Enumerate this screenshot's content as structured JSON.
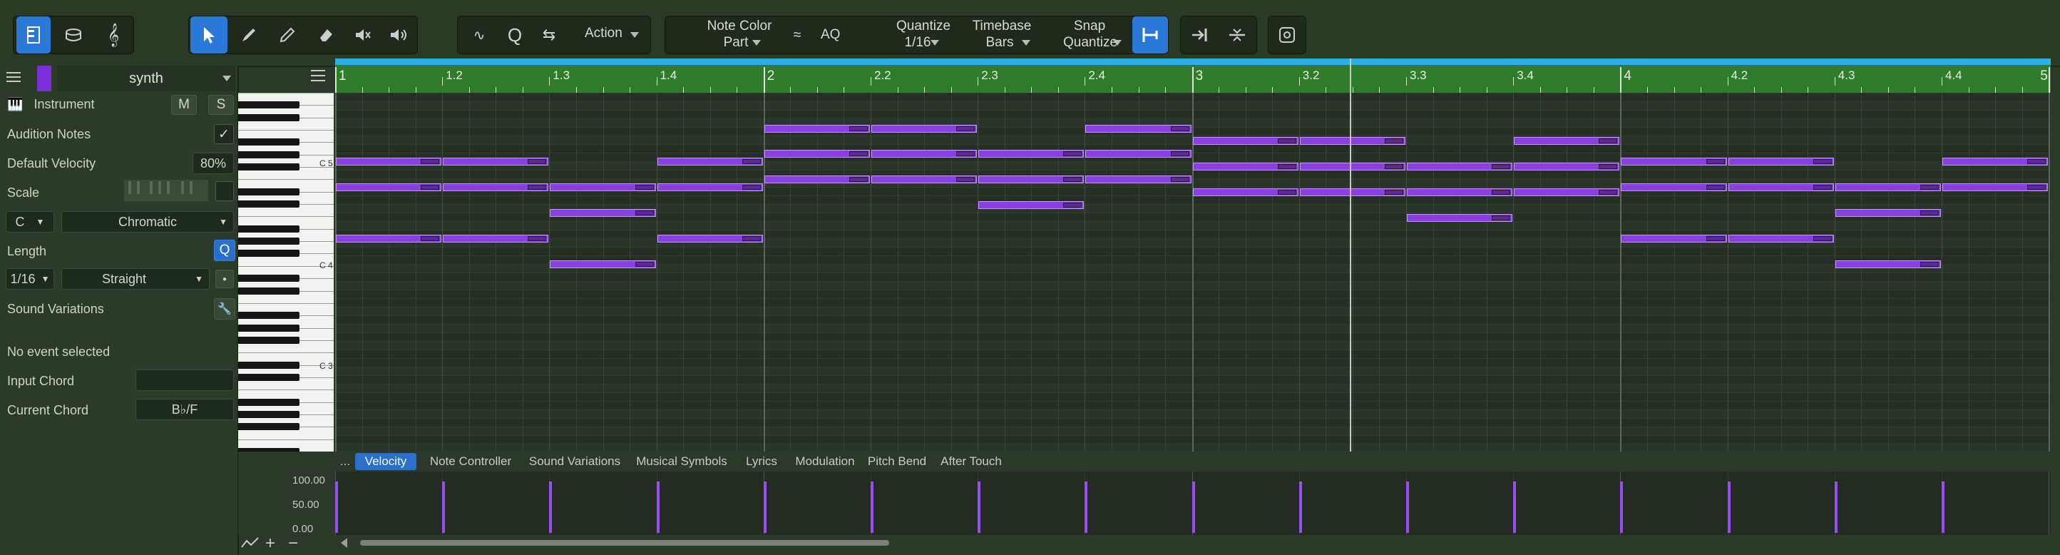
{
  "toolbar": {
    "action_label": "Action",
    "note_color": {
      "label": "Note Color",
      "value": "Part"
    },
    "aq_label": "AQ",
    "quantize": {
      "label": "Quantize",
      "value": "1/16"
    },
    "timebase": {
      "label": "Timebase",
      "value": "Bars"
    },
    "snap": {
      "label": "Snap",
      "value": "Quantize"
    }
  },
  "inspector": {
    "track_name": "synth",
    "instrument_label": "Instrument",
    "mute_label": "M",
    "solo_label": "S",
    "audition_label": "Audition Notes",
    "velocity_label": "Default Velocity",
    "velocity_value": "80%",
    "scale_label": "Scale",
    "scale_root": "C",
    "scale_type": "Chromatic",
    "length_label": "Length",
    "length_value": "1/16",
    "length_mode": "Straight",
    "sound_variations_label": "Sound Variations",
    "no_event": "No event selected",
    "input_chord_label": "Input Chord",
    "current_chord_label": "Current Chord",
    "current_chord_value": "B♭/F"
  },
  "keyboard": {
    "labels": [
      "C 5",
      "C 4",
      "C 3"
    ]
  },
  "ruler": {
    "labels": [
      "1",
      "1.2",
      "1.3",
      "1.4",
      "2",
      "2.2",
      "2.3",
      "2.4",
      "3",
      "3.2",
      "3.3",
      "3.4",
      "4",
      "4.2",
      "4.3",
      "4.4",
      "5"
    ]
  },
  "lanes": {
    "more": "...",
    "tabs": [
      "Velocity",
      "Note Controller",
      "Sound Variations",
      "Musical Symbols",
      "Lyrics",
      "Modulation",
      "Pitch Bend",
      "After Touch"
    ],
    "scale": [
      "100.00",
      "50.00",
      "0.00"
    ]
  },
  "notes": [
    {
      "beat": 0,
      "len": 1,
      "row": 0
    },
    {
      "beat": 1,
      "len": 1,
      "row": 0
    },
    {
      "beat": 3,
      "len": 1,
      "row": 0
    },
    {
      "beat": 0,
      "len": 1,
      "row": 1
    },
    {
      "beat": 1,
      "len": 1,
      "row": 1
    },
    {
      "beat": 2,
      "len": 1,
      "row": 1
    },
    {
      "beat": 3,
      "len": 1,
      "row": 1
    },
    {
      "beat": 2,
      "len": 1,
      "row": 2
    },
    {
      "beat": 0,
      "len": 1,
      "row": 3
    },
    {
      "beat": 1,
      "len": 1,
      "row": 3
    },
    {
      "beat": 3,
      "len": 1,
      "row": 3
    },
    {
      "beat": 2,
      "len": 1,
      "row": 4
    },
    {
      "beat": 4,
      "len": 1,
      "row": 5
    },
    {
      "beat": 5,
      "len": 1,
      "row": 5
    },
    {
      "beat": 7,
      "len": 1,
      "row": 5
    },
    {
      "beat": 4,
      "len": 1,
      "row": 6
    },
    {
      "beat": 5,
      "len": 1,
      "row": 6
    },
    {
      "beat": 6,
      "len": 1,
      "row": 6
    },
    {
      "beat": 7,
      "len": 1,
      "row": 6
    },
    {
      "beat": 6,
      "len": 1,
      "row": 7
    },
    {
      "beat": 4,
      "len": 1,
      "row": 8
    },
    {
      "beat": 5,
      "len": 1,
      "row": 8
    },
    {
      "beat": 7,
      "len": 1,
      "row": 8
    },
    {
      "beat": 6,
      "len": 1,
      "row": 9
    },
    {
      "beat": 8,
      "len": 1,
      "row": 10
    },
    {
      "beat": 9,
      "len": 1,
      "row": 10
    },
    {
      "beat": 11,
      "len": 1,
      "row": 10
    },
    {
      "beat": 8,
      "len": 1,
      "row": 11
    },
    {
      "beat": 9,
      "len": 1,
      "row": 11
    },
    {
      "beat": 10,
      "len": 1,
      "row": 11
    },
    {
      "beat": 11,
      "len": 1,
      "row": 11
    },
    {
      "beat": 10,
      "len": 1,
      "row": 12
    },
    {
      "beat": 8,
      "len": 1,
      "row": 13
    },
    {
      "beat": 9,
      "len": 1,
      "row": 13
    },
    {
      "beat": 11,
      "len": 1,
      "row": 13
    },
    {
      "beat": 10,
      "len": 1,
      "row": 14
    },
    {
      "beat": 12,
      "len": 1,
      "row": 15
    },
    {
      "beat": 13,
      "len": 1,
      "row": 15
    },
    {
      "beat": 15,
      "len": 1,
      "row": 15
    },
    {
      "beat": 12,
      "len": 1,
      "row": 16
    },
    {
      "beat": 13,
      "len": 1,
      "row": 16
    },
    {
      "beat": 14,
      "len": 1,
      "row": 16
    },
    {
      "beat": 15,
      "len": 1,
      "row": 16
    },
    {
      "beat": 14,
      "len": 1,
      "row": 17
    },
    {
      "beat": 12,
      "len": 1,
      "row": 18
    },
    {
      "beat": 13,
      "len": 1,
      "row": 18
    },
    {
      "beat": 14,
      "len": 1,
      "row": 19
    }
  ],
  "velocities": [
    1,
    1,
    1,
    1,
    1,
    1,
    1,
    1,
    1,
    1,
    1,
    1,
    1,
    1,
    1,
    1
  ],
  "colors": {
    "note": "#8a3fe0",
    "velocity": "#9a4ef2",
    "ruler": "#2f7d2b",
    "accent": "#2a78d8"
  }
}
